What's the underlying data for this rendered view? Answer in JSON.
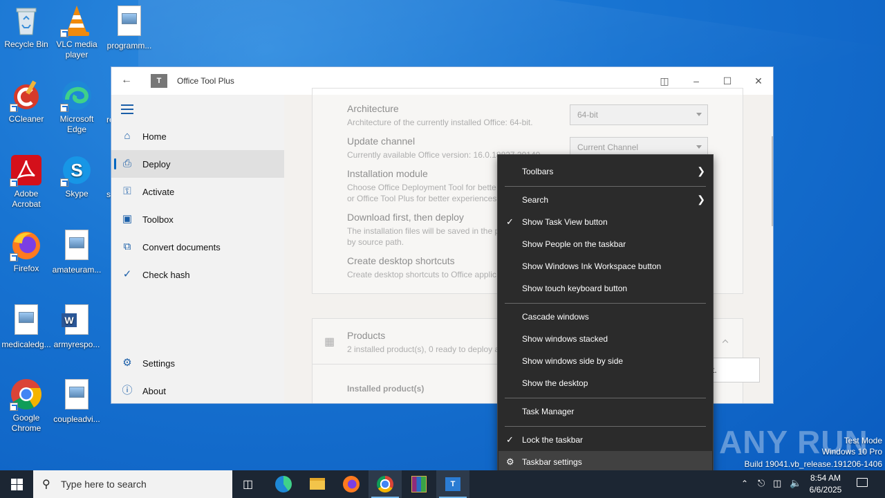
{
  "desktop": {
    "icons": [
      {
        "label": "Recycle Bin"
      },
      {
        "label": "VLC media player"
      },
      {
        "label": "programm..."
      },
      {
        "label": "CCleaner"
      },
      {
        "label": "Microsoft Edge"
      },
      {
        "label": "Adobe Acrobat"
      },
      {
        "label": "Skype"
      },
      {
        "label": "Firefox"
      },
      {
        "label": "amateuram..."
      },
      {
        "label": "medicaledg..."
      },
      {
        "label": "armyrespo..."
      },
      {
        "label": "Google Chrome"
      },
      {
        "label": "coupleadvi..."
      }
    ],
    "partial_labels": {
      "r1": "re",
      "r2": "s"
    }
  },
  "window": {
    "title": "Office Tool Plus",
    "logo_text": "T",
    "sidebar": {
      "items": [
        {
          "label": "Home"
        },
        {
          "label": "Deploy"
        },
        {
          "label": "Activate"
        },
        {
          "label": "Toolbox"
        },
        {
          "label": "Convert documents"
        },
        {
          "label": "Check hash"
        }
      ],
      "bottom_items": [
        {
          "label": "Settings"
        },
        {
          "label": "About"
        }
      ]
    },
    "content": {
      "settings": [
        {
          "title": "Architecture",
          "desc": "Architecture of the currently installed Office: 64-bit.",
          "value": "64-bit"
        },
        {
          "title": "Update channel",
          "desc": "Currently available Office version: 16.0.18827.20140",
          "value": "Current Channel"
        },
        {
          "title": "Installation module",
          "desc": "Choose Office Deployment Tool for bette",
          "desc2": "or Office Tool Plus for better experiences."
        },
        {
          "title": "Download first, then deploy",
          "desc": "The installation files will be saved in the p",
          "desc2": "by source path."
        },
        {
          "title": "Create desktop shortcuts",
          "desc": "Create desktop shortcuts to Office applic"
        }
      ],
      "products": {
        "title": "Products",
        "desc": "2 installed product(s), 0 ready to deploy a",
        "installed_label": "Installed product(s)",
        "box_text": "t."
      }
    }
  },
  "context_menu": {
    "items": {
      "toolbars": "Toolbars",
      "search": "Search",
      "task_view": "Show Task View button",
      "people": "Show People on the taskbar",
      "ink": "Show Windows Ink Workspace button",
      "touch_keyboard": "Show touch keyboard button",
      "cascade": "Cascade windows",
      "stacked": "Show windows stacked",
      "side_by_side": "Show windows side by side",
      "show_desktop": "Show the desktop",
      "task_manager": "Task Manager",
      "lock": "Lock the taskbar",
      "settings": "Taskbar settings"
    }
  },
  "watermark": {
    "brand": "ANY RUN",
    "mode": "Test Mode",
    "os": "Windows 10 Pro",
    "build": "Build 19041.vb_release.191206-1406"
  },
  "taskbar": {
    "search_placeholder": "Type here to search",
    "clock_time": "8:54 AM",
    "clock_date": "6/6/2025"
  },
  "colors": {
    "accent": "#0067c0",
    "menu_bg": "#2b2b2b",
    "taskbar_bg": "#1c2633"
  }
}
